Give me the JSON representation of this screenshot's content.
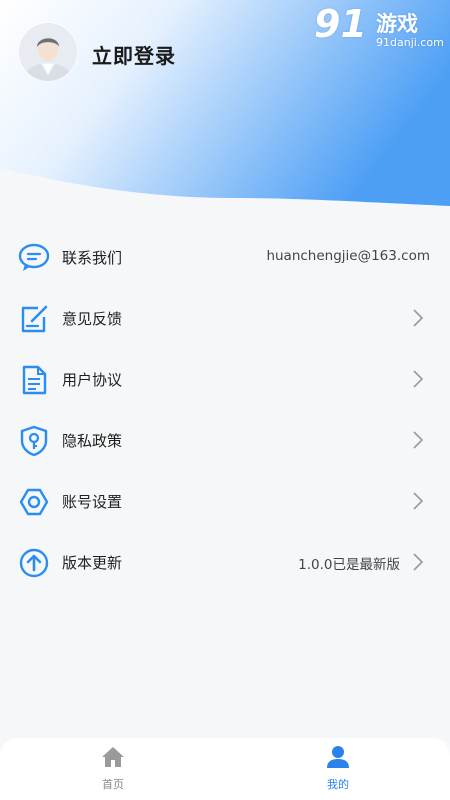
{
  "header": {
    "login_label": "立即登录",
    "gradient_start": "#ffffff",
    "gradient_end": "#4d9ff5"
  },
  "watermark": {
    "logo_number": "91",
    "logo_text": "游戏",
    "url": "91danji.com"
  },
  "menu": {
    "items": [
      {
        "icon": "chat-bubble-icon",
        "label": "联系我们",
        "value": "huanchengjie@163.com",
        "has_chevron": false
      },
      {
        "icon": "edit-note-icon",
        "label": "意见反馈",
        "value": "",
        "has_chevron": true
      },
      {
        "icon": "document-icon",
        "label": "用户协议",
        "value": "",
        "has_chevron": true
      },
      {
        "icon": "shield-key-icon",
        "label": "隐私政策",
        "value": "",
        "has_chevron": true
      },
      {
        "icon": "gear-icon",
        "label": "账号设置",
        "value": "",
        "has_chevron": true
      },
      {
        "icon": "upload-arrow-icon",
        "label": "版本更新",
        "value": "1.0.0已是最新版",
        "has_chevron": true
      }
    ]
  },
  "tabbar": {
    "tabs": [
      {
        "icon": "home-icon",
        "label": "首页",
        "active": false
      },
      {
        "icon": "user-icon",
        "label": "我的",
        "active": true
      }
    ]
  },
  "colors": {
    "accent": "#2a82ea",
    "icon_blue": "#2a8ef0",
    "background": "#f6f7f9"
  }
}
